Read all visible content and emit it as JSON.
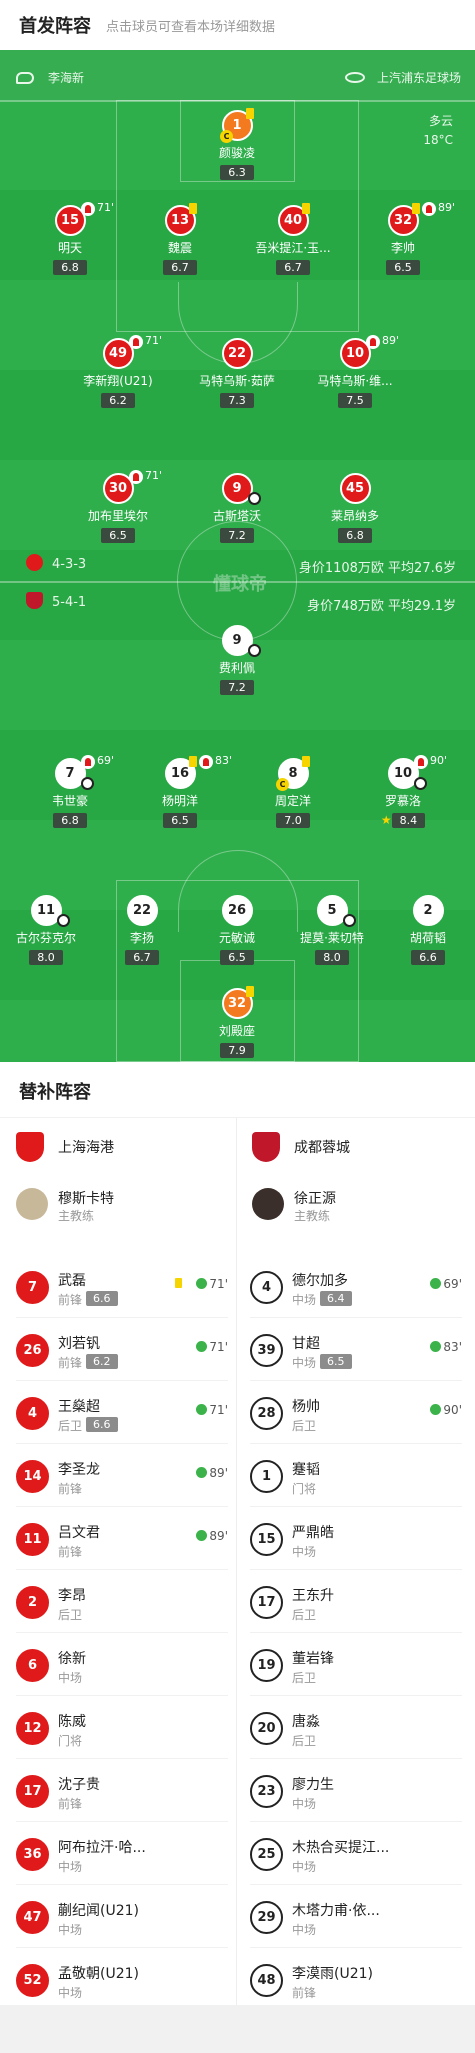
{
  "header": {
    "title": "首发阵容",
    "subtitle": "点击球员可查看本场详细数据"
  },
  "pitch": {
    "referee": "李海新",
    "stadium": "上汽浦东足球场",
    "weather": {
      "condition": "多云",
      "temp": "18°C"
    },
    "watermark": "懂球帝",
    "home": {
      "formation": "4-3-3",
      "info": "身价1108万欧 平均27.6岁",
      "color": "#e01a1a"
    },
    "away": {
      "formation": "5-4-1",
      "info": "身价748万欧 平均29.1岁",
      "color": "#c0182a"
    }
  },
  "home_players": [
    {
      "no": "1",
      "name": "颜骏凌",
      "rating": "6.3",
      "style": "orange",
      "card": true,
      "captain": true
    },
    {
      "no": "15",
      "name": "明天",
      "rating": "6.8",
      "style": "red",
      "subout": "71'"
    },
    {
      "no": "13",
      "name": "魏震",
      "rating": "6.7",
      "style": "red",
      "card": true
    },
    {
      "no": "40",
      "name": "吾米提江·玉...",
      "rating": "6.7",
      "style": "red",
      "card": true
    },
    {
      "no": "32",
      "name": "李帅",
      "rating": "6.5",
      "style": "red",
      "card": true,
      "subout": "89'"
    },
    {
      "no": "49",
      "name": "李新翔(U21)",
      "rating": "6.2",
      "style": "red",
      "subout": "71'"
    },
    {
      "no": "22",
      "name": "马特乌斯·茹萨",
      "rating": "7.3",
      "style": "red"
    },
    {
      "no": "10",
      "name": "马特乌斯·维...",
      "rating": "7.5",
      "style": "red",
      "subout": "89'"
    },
    {
      "no": "30",
      "name": "加布里埃尔",
      "rating": "6.5",
      "style": "red",
      "subout": "71'"
    },
    {
      "no": "9",
      "name": "古斯塔沃",
      "rating": "7.2",
      "style": "red",
      "goal": true
    },
    {
      "no": "45",
      "name": "莱昂纳多",
      "rating": "6.8",
      "style": "red"
    }
  ],
  "away_players": [
    {
      "no": "9",
      "name": "费利佩",
      "rating": "7.2",
      "style": "white",
      "goal": true
    },
    {
      "no": "7",
      "name": "韦世豪",
      "rating": "6.8",
      "style": "white",
      "subout": "69'",
      "goal": true
    },
    {
      "no": "16",
      "name": "杨明洋",
      "rating": "6.5",
      "style": "white",
      "card": true,
      "subout": "83'"
    },
    {
      "no": "8",
      "name": "周定洋",
      "rating": "7.0",
      "style": "white",
      "card": true,
      "captain": true
    },
    {
      "no": "10",
      "name": "罗慕洛",
      "rating": "8.4",
      "style": "white",
      "subout": "90'",
      "goal": true,
      "star": true
    },
    {
      "no": "11",
      "name": "古尔芬克尔",
      "rating": "8.0",
      "style": "white",
      "goal": true
    },
    {
      "no": "22",
      "name": "李扬",
      "rating": "6.7",
      "style": "white"
    },
    {
      "no": "26",
      "name": "元敏诚",
      "rating": "6.5",
      "style": "white"
    },
    {
      "no": "5",
      "name": "提莫·莱切特",
      "rating": "8.0",
      "style": "white",
      "goal": true
    },
    {
      "no": "2",
      "name": "胡荷韬",
      "rating": "6.6",
      "style": "white"
    },
    {
      "no": "32",
      "name": "刘殿座",
      "rating": "7.9",
      "style": "orange",
      "card": true
    }
  ],
  "subs": {
    "title": "替补阵容",
    "home_team": "上海海港",
    "away_team": "成都蓉城",
    "home_coach": {
      "name": "穆斯卡特",
      "role": "主教练"
    },
    "away_coach": {
      "name": "徐正源",
      "role": "主教练"
    },
    "home": [
      {
        "no": "7",
        "name": "武磊",
        "pos": "前锋",
        "rating": "6.6",
        "time": "71'",
        "card": true
      },
      {
        "no": "26",
        "name": "刘若钒",
        "pos": "前锋",
        "rating": "6.2",
        "time": "71'"
      },
      {
        "no": "4",
        "name": "王燊超",
        "pos": "后卫",
        "rating": "6.6",
        "time": "71'"
      },
      {
        "no": "14",
        "name": "李圣龙",
        "pos": "前锋",
        "time": "89'"
      },
      {
        "no": "11",
        "name": "吕文君",
        "pos": "前锋",
        "time": "89'"
      },
      {
        "no": "2",
        "name": "李昂",
        "pos": "后卫"
      },
      {
        "no": "6",
        "name": "徐新",
        "pos": "中场"
      },
      {
        "no": "12",
        "name": "陈威",
        "pos": "门将"
      },
      {
        "no": "17",
        "name": "沈子贵",
        "pos": "前锋"
      },
      {
        "no": "36",
        "name": "阿布拉汗·哈...",
        "pos": "中场"
      },
      {
        "no": "47",
        "name": "蒯纪闻(U21)",
        "pos": "中场"
      },
      {
        "no": "52",
        "name": "孟敬朝(U21)",
        "pos": "中场"
      }
    ],
    "away": [
      {
        "no": "4",
        "name": "德尔加多",
        "pos": "中场",
        "rating": "6.4",
        "time": "69'"
      },
      {
        "no": "39",
        "name": "甘超",
        "pos": "中场",
        "rating": "6.5",
        "time": "83'"
      },
      {
        "no": "28",
        "name": "杨帅",
        "pos": "后卫",
        "time": "90'"
      },
      {
        "no": "1",
        "name": "蹇韬",
        "pos": "门将"
      },
      {
        "no": "15",
        "name": "严鼎皓",
        "pos": "中场"
      },
      {
        "no": "17",
        "name": "王东升",
        "pos": "后卫"
      },
      {
        "no": "19",
        "name": "董岩锋",
        "pos": "后卫"
      },
      {
        "no": "20",
        "name": "唐淼",
        "pos": "后卫"
      },
      {
        "no": "23",
        "name": "廖力生",
        "pos": "中场"
      },
      {
        "no": "25",
        "name": "木热合买提江...",
        "pos": "中场"
      },
      {
        "no": "29",
        "name": "木塔力甫·依...",
        "pos": "中场"
      },
      {
        "no": "48",
        "name": "李漠雨(U21)",
        "pos": "前锋"
      }
    ]
  }
}
